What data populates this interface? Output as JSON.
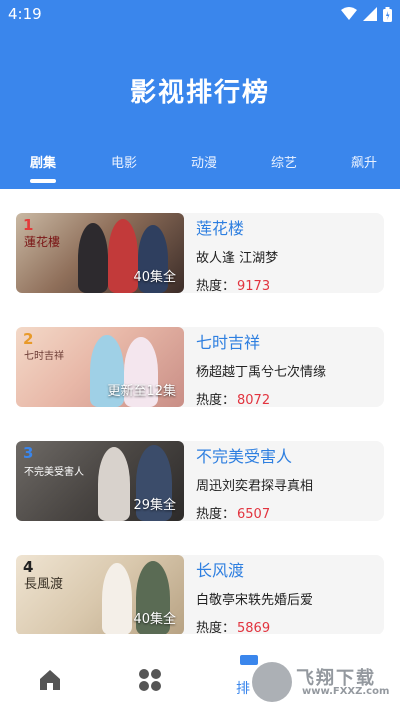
{
  "status": {
    "time": "4:19"
  },
  "header": {
    "title": "影视排行榜"
  },
  "tabs": [
    {
      "label": "剧集",
      "active": true
    },
    {
      "label": "电影"
    },
    {
      "label": "动漫"
    },
    {
      "label": "综艺"
    },
    {
      "label": "飙升"
    }
  ],
  "items": [
    {
      "rank": "1",
      "name": "莲花楼",
      "desc": "故人逢 江湖梦",
      "heat_label": "热度：",
      "heat": "9173",
      "episodes": "40集全",
      "poster_text": "蓮花樓",
      "rank_color": "#e23b3b"
    },
    {
      "rank": "2",
      "name": "七时吉祥",
      "desc": "杨超越丁禹兮七次情缘",
      "heat_label": "热度：",
      "heat": "8072",
      "episodes": "更新至12集",
      "poster_text": "七时吉祥",
      "rank_color": "#e89a2a"
    },
    {
      "rank": "3",
      "name": "不完美受害人",
      "desc": "周迅刘奕君探寻真相",
      "heat_label": "热度：",
      "heat": "6507",
      "episodes": "29集全",
      "poster_text": "不完美受害人",
      "rank_color": "#3a86ec"
    },
    {
      "rank": "4",
      "name": "长风渡",
      "desc": "白敬亭宋轶先婚后爱",
      "heat_label": "热度：",
      "heat": "5869",
      "episodes": "40集全",
      "poster_text": "長風渡",
      "rank_color": "#222222"
    }
  ],
  "bottom_nav": {
    "active_label": "排"
  },
  "watermark": {
    "text": "飞翔下载",
    "url": "www.FXXZ.com"
  },
  "colors": {
    "accent": "#3a86ec",
    "heat": "#e2343f",
    "title_blue": "#2e7fe0"
  }
}
